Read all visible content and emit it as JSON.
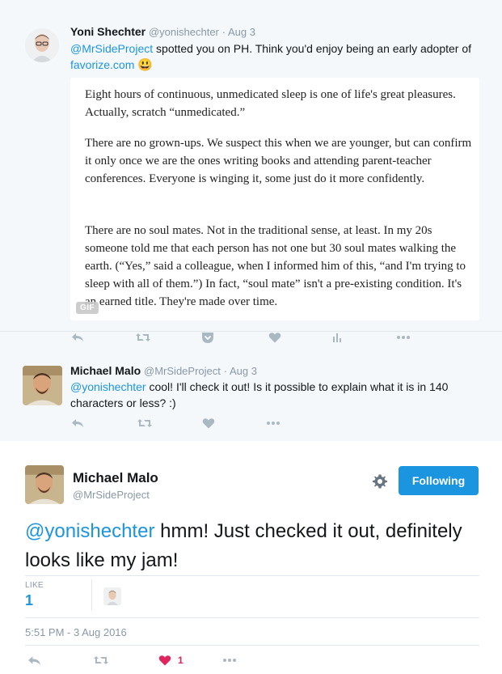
{
  "tweet1": {
    "name": "Yoni Shechter",
    "screen_name": "@yonishechter",
    "date": "· Aug 3",
    "mention": "@MrSideProject",
    "text_mid": "spotted you on PH. Think you'd enjoy being an early adopter of",
    "link": "favorize.com",
    "emoji": "😃",
    "quote_paragraphs": [
      "Eight hours of continuous, unmedicated sleep is one of life's great pleasures. Actually, scratch “unmedicated.”",
      "There are no grown-ups. We suspect this when we are younger, but can confirm it only once we are the ones writing books and attending parent-teacher conferences. Everyone is winging it, some just do it more confidently.",
      "There are no soul mates. Not in the traditional sense, at least. In my 20s someone told me that each person has not one but 30 soul mates walking the earth. (“Yes,” said a colleague, when I informed him of this, “and I'm trying to sleep with all of them.”) In fact, “soul mate” isn't a pre-existing condition. It's an earned title. They're made over time."
    ],
    "gif_label": "GIF"
  },
  "tweet2": {
    "name": "Michael Malo",
    "screen_name": "@MrSideProject",
    "date": "· Aug 3",
    "mention": "@yonishechter",
    "text": "cool! I'll check it out! Is it possible to explain what it is in 140 characters or less? :)"
  },
  "main": {
    "name": "Michael Malo",
    "screen_name": "@MrSideProject",
    "follow_label": "Following",
    "mention": "@yonishechter",
    "text": " hmm! Just checked it out, definitely looks like my jam!",
    "like_label": "LIKE",
    "like_count": "1",
    "timestamp": "5:51 PM - 3 Aug 2016",
    "heart_count": "1"
  },
  "colors": {
    "accent": "#1b95e0",
    "heart": "#e0245e",
    "icon_grey": "#aab8c2",
    "conversation_bg": "#f5f8fa"
  },
  "icons": [
    "reply-icon",
    "retweet-icon",
    "pocket-icon",
    "heart-icon",
    "analytics-icon",
    "more-icon",
    "gear-icon"
  ]
}
